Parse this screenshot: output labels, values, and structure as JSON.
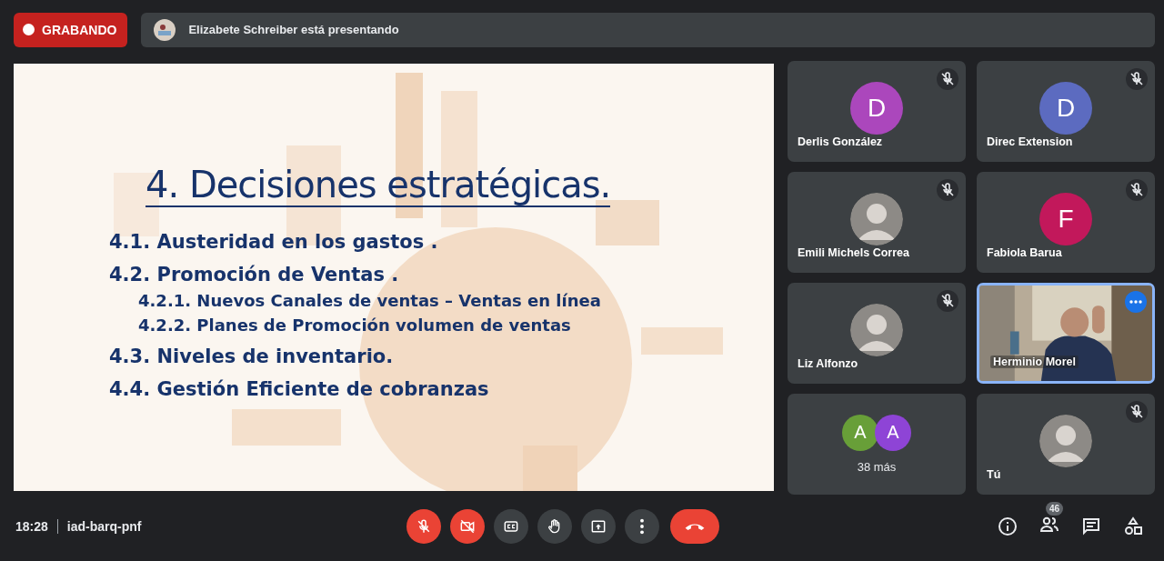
{
  "recording": {
    "label": "GRABANDO"
  },
  "presenter_banner": {
    "text": "Elizabete Schreiber está presentando"
  },
  "slide": {
    "kind": "picture",
    "title": "4. Decisiones estratégicas.",
    "items": [
      {
        "text": "4.1. Austeridad en los gastos ."
      },
      {
        "text": "4.2. Promoción de Ventas .",
        "children": [
          {
            "text": "4.2.1. Nuevos Canales de ventas – Ventas en línea"
          },
          {
            "text": "4.2.2. Planes de Promoción volumen de ventas"
          }
        ]
      },
      {
        "text": "4.3. Niveles de inventario."
      },
      {
        "text": "4.4. Gestión Eficiente de cobranzas"
      }
    ]
  },
  "tiles": [
    {
      "kind": "initial",
      "name": "Derlis González",
      "initial": "D",
      "color": "#ab47bc",
      "muted": true,
      "active": false
    },
    {
      "kind": "initial",
      "name": "Direc Extension",
      "initial": "D",
      "color": "#5c6bc0",
      "muted": true,
      "active": false
    },
    {
      "name": "Emili Michels Correa",
      "muted": true,
      "active": false
    },
    {
      "kind": "initial",
      "name": "Fabiola Barua",
      "initial": "F",
      "color": "#c2185b",
      "muted": true,
      "active": false
    },
    {
      "name": "Liz Alfonzo",
      "muted": true,
      "active": false
    },
    {
      "kind": "video",
      "name": "Herminio Morel",
      "muted": false,
      "active": true
    },
    {
      "kind": "more",
      "label": "38 más",
      "avatars": [
        {
          "initial": "A",
          "color": "#689f38"
        },
        {
          "initial": "A",
          "color": "#8e44d6"
        }
      ],
      "muted": false,
      "active": false
    },
    {
      "name": "Tú",
      "muted": true,
      "active": false
    }
  ],
  "bottom_bar": {
    "time": "18:28",
    "meeting_code": "iad-barq-pnf",
    "controls": [
      {
        "kind": "mic",
        "off": true
      },
      {
        "kind": "camera",
        "off": true
      },
      {
        "kind": "captions",
        "off": false
      },
      {
        "kind": "hand",
        "off": false
      },
      {
        "kind": "present",
        "off": false
      },
      {
        "kind": "more",
        "off": false
      },
      {
        "kind": "hangup"
      }
    ],
    "participant_count": "46"
  }
}
